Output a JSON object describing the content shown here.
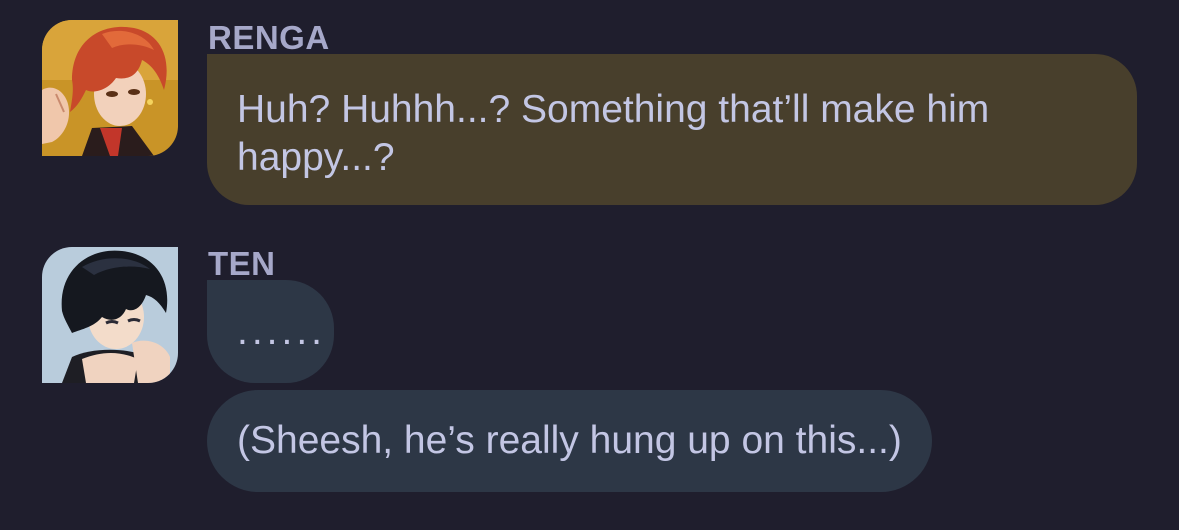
{
  "messages": [
    {
      "speaker": "RENGA",
      "avatar": "renga-avatar",
      "bubble_color": "#483f2c",
      "lines": [
        "Huh? Huhhh...? Something that’ll make him happy...?"
      ]
    },
    {
      "speaker": "TEN",
      "avatar": "ten-avatar",
      "bubble_color": "#2d3746",
      "lines": [
        "......",
        "(Sheesh, he’s really hung up on this...)"
      ]
    }
  ],
  "colors": {
    "background": "#1f1e2d",
    "name_text": "#a6a8c9",
    "message_text": "#c3c6e4"
  }
}
